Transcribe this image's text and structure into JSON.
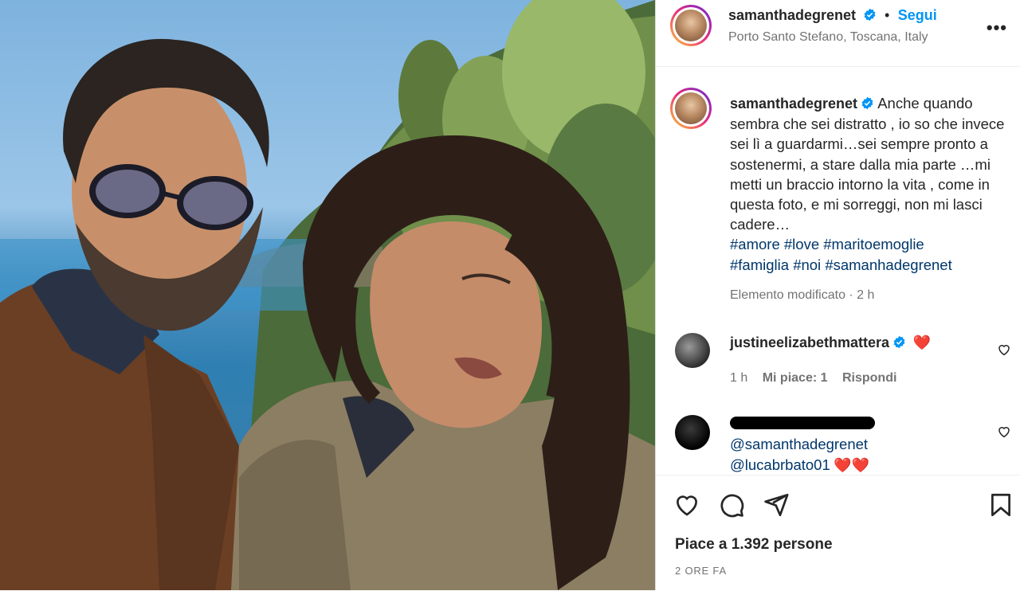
{
  "post": {
    "author": "samanthadegrenet",
    "follow_label": "Segui",
    "separator": "•",
    "location": "Porto Santo Stefano, Toscana, Italy",
    "more_label": "•••"
  },
  "caption": {
    "author": "samanthadegrenet",
    "text": "Anche quando sembra che sei distratto , io so che invece sei lì a guardarmi…sei sempre pronto a sostenermi, a stare dalla mia parte …mi metti un braccio intorno la vita , come in questa foto, e mi sorreggi, non mi lasci cadere…",
    "hashtags": [
      "#amore",
      "#love",
      "#maritoemoglie",
      "#famiglia",
      "#noi",
      "#samanhadegrenet"
    ],
    "meta": "Elemento modificato · 2 h"
  },
  "comments": [
    {
      "user": "justineelizabethmattera",
      "text": "❤️",
      "time": "1 h",
      "likes": "Mi piace: 1",
      "reply": "Rispondi"
    },
    {
      "user": "",
      "mention1": "@samanthadegrenet",
      "mention2": "@lucabrbato01",
      "text": "❤️❤️"
    }
  ],
  "footer": {
    "likes": "Piace a 1.392 persone",
    "time": "2 ORE FA"
  },
  "colors": {
    "accent": "#0095f6",
    "hashtag": "#00376b",
    "verified": "#0095f6"
  },
  "icons": [
    "heart-icon",
    "comment-icon",
    "share-icon",
    "bookmark-icon",
    "verified-icon",
    "more-icon"
  ]
}
